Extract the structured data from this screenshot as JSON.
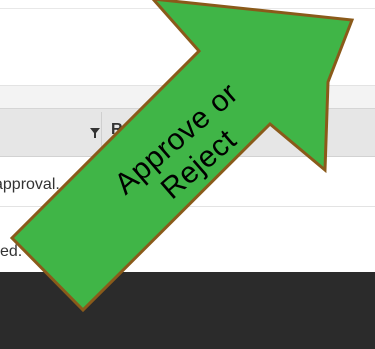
{
  "grid": {
    "column_header": "Re",
    "row_1_text": "approval.",
    "row_2_text": "ved."
  },
  "annotation": {
    "line_1": "Approve or",
    "line_2": "Reject",
    "fill_color": "#40b547",
    "stroke_color": "#8a5a1a"
  }
}
